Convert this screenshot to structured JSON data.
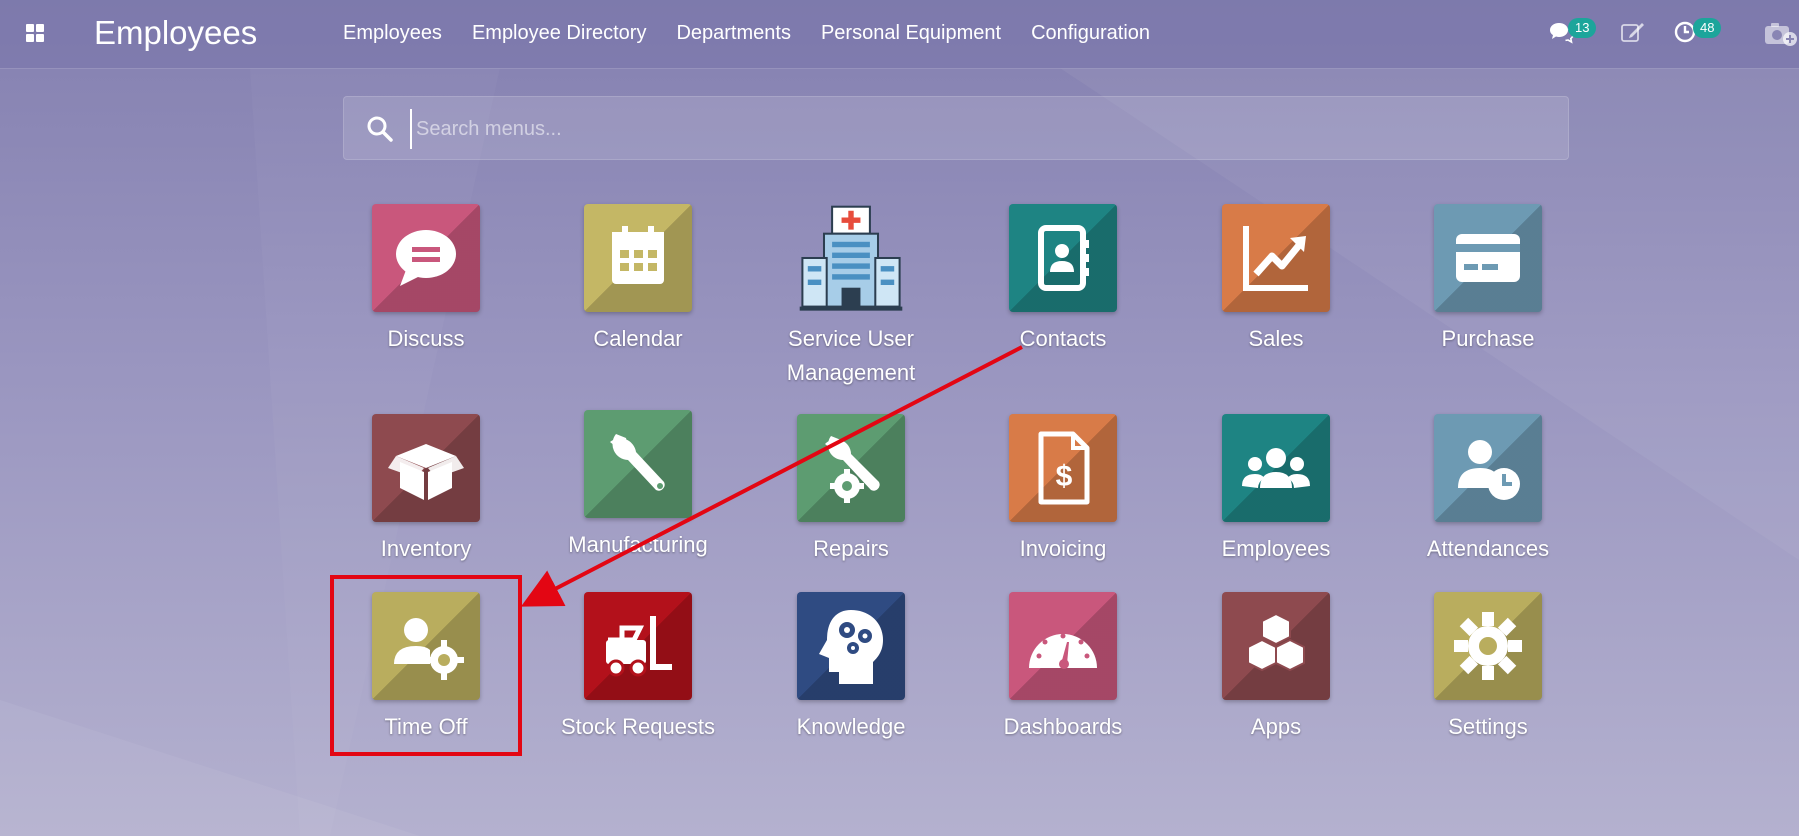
{
  "topbar": {
    "app_title": "Employees",
    "menu": [
      "Employees",
      "Employee Directory",
      "Departments",
      "Personal Equipment",
      "Configuration"
    ],
    "messages_badge": "13",
    "activities_badge": "48"
  },
  "search": {
    "placeholder": "Search menus..."
  },
  "apps": [
    {
      "label": "Discuss",
      "color": "#c9577c",
      "icon": "chat-bubble-icon"
    },
    {
      "label": "Calendar",
      "color": "#c4b765",
      "icon": "calendar-icon"
    },
    {
      "label": "Service User Management",
      "color": "transparent",
      "icon": "hospital-building-icon"
    },
    {
      "label": "Contacts",
      "color": "#1e8483",
      "icon": "contact-book-icon"
    },
    {
      "label": "Sales",
      "color": "#d87b48",
      "icon": "trend-chart-icon"
    },
    {
      "label": "Purchase",
      "color": "#6d9ab3",
      "icon": "credit-card-icon"
    },
    {
      "label": "Inventory",
      "color": "#8e4a4f",
      "icon": "open-box-icon"
    },
    {
      "label": "Manufacturing",
      "color": "#5d9c71",
      "icon": "wrench-icon"
    },
    {
      "label": "Repairs",
      "color": "#5d9c71",
      "icon": "wrench-gear-icon"
    },
    {
      "label": "Invoicing",
      "color": "#d87b48",
      "icon": "invoice-dollar-icon"
    },
    {
      "label": "Employees",
      "color": "#1e8483",
      "icon": "people-group-icon"
    },
    {
      "label": "Attendances",
      "color": "#6d9ab3",
      "icon": "user-clock-icon"
    },
    {
      "label": "Time Off",
      "color": "#b9ad5e",
      "icon": "user-gear-icon"
    },
    {
      "label": "Stock Requests",
      "color": "#b3111b",
      "icon": "forklift-icon"
    },
    {
      "label": "Knowledge",
      "color": "#2f4b82",
      "icon": "head-gears-icon"
    },
    {
      "label": "Dashboards",
      "color": "#c9577c",
      "icon": "speedometer-icon"
    },
    {
      "label": "Apps",
      "color": "#8e4a4f",
      "icon": "cubes-icon"
    },
    {
      "label": "Settings",
      "color": "#b9ad5e",
      "icon": "gear-icon"
    }
  ],
  "annotation": {
    "color": "#e30613"
  }
}
